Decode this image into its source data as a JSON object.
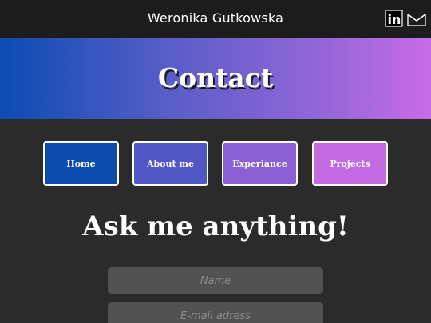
{
  "header": {
    "site_name": "Weronika Gutkowska",
    "social": [
      {
        "icon": "linkedin-icon",
        "label": "in"
      },
      {
        "icon": "mail-icon"
      }
    ]
  },
  "hero": {
    "title": "Contact",
    "gradient": [
      "#0b4cb3",
      "#c86ce6"
    ]
  },
  "nav": {
    "items": [
      {
        "label": "Home",
        "color": "#0b4cae"
      },
      {
        "label": "About me",
        "color": "#5157c4"
      },
      {
        "label": "Experiance",
        "color": "#8a60d4"
      },
      {
        "label": "Projects",
        "color": "#c46be4"
      }
    ]
  },
  "main": {
    "heading": "Ask me anything!"
  },
  "form": {
    "name": {
      "value": "",
      "placeholder": "Name"
    },
    "email": {
      "value": "",
      "placeholder": "E-mail adress"
    }
  },
  "colors": {
    "background": "#2b2b2b",
    "topbar": "#1c1c1c",
    "field": "#525252"
  }
}
